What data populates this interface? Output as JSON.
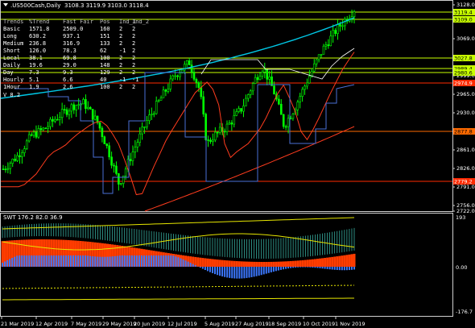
{
  "chart_window": {
    "symbol_title": ".US500Cash,Daily",
    "ohlc_text": "3108.3 3119.9 3103.0 3118.4"
  },
  "panel_table": {
    "headers": [
      "Trends",
      "%Trend",
      "Fast Fair",
      "Pos",
      "Ind_1",
      "Ind_2"
    ],
    "rows": [
      {
        "name": "Basic",
        "c1": "1571.8",
        "c2": "2509.0",
        "c3": "160",
        "c4": "2",
        "c5": "2"
      },
      {
        "name": "Long",
        "c1": "630.2",
        "c2": "937.1",
        "c3": "151",
        "c4": "2",
        "c5": "2"
      },
      {
        "name": "Medium",
        "c1": "236.8",
        "c2": "316.9",
        "c3": "133",
        "c4": "2",
        "c5": "2"
      },
      {
        "name": "Short",
        "c1": "126.0",
        "c2": "78.3",
        "c3": "62",
        "c4": "-1",
        "c5": "2"
      },
      {
        "name": "Local",
        "c1": "38.1",
        "c2": "69.8",
        "c3": "100",
        "c4": "2",
        "c5": "2"
      },
      {
        "name": "Daily",
        "c1": "19.6",
        "c2": "29.0",
        "c3": "148",
        "c4": "2",
        "c5": "2"
      },
      {
        "name": "Day",
        "c1": "7.3",
        "c2": "9.3",
        "c3": "129",
        "c4": "2",
        "c5": "2"
      },
      {
        "name": "Hourly",
        "c1": "5.1",
        "c2": "6.6",
        "c3": "40",
        "c4": "-1",
        "c5": "-1"
      },
      {
        "name": "1Hour",
        "c1": "1.9",
        "c2": "2.6",
        "c3": "100",
        "c4": "2",
        "c5": "2"
      }
    ],
    "footer": "V 8.2"
  },
  "price_scale": [
    "3128.0",
    "3104.0",
    "3069.0",
    "3034.0",
    "2999.0",
    "2965.0",
    "2930.0",
    "2896.0",
    "2861.0",
    "2826.0",
    "2791.0",
    "2756.0",
    "2722.0"
  ],
  "price_tags": [
    {
      "value": "3119.4",
      "color": "#c8ff00",
      "text_color": "#000000"
    },
    {
      "value": "3109.0",
      "color": "#c8ff00",
      "text_color": "#000000"
    },
    {
      "value": "3027.8",
      "color": "#c8ff00",
      "text_color": "#000000"
    },
    {
      "value": "2989.4",
      "color": "#c8ff00",
      "text_color": "#000000"
    },
    {
      "value": "2980.6",
      "color": "#c8ff00",
      "text_color": "#000000"
    },
    {
      "value": "2974.9",
      "color": "#ff2a00",
      "text_color": "#ffffff"
    },
    {
      "value": "2877.8",
      "color": "#ff6a00",
      "text_color": "#000000"
    },
    {
      "value": "2779.2",
      "color": "#ff2a00",
      "text_color": "#ffffff"
    }
  ],
  "subwindow": {
    "title": "SWT 176.2 82.0 36.9",
    "scale": [
      "193",
      "0.00",
      "-176.7"
    ]
  },
  "time_axis": [
    "21 Mar 2019",
    "12 Apr 2019",
    "7 May 2019",
    "29 May 2019",
    "20 Jun 2019",
    "12 Jul 2019",
    "5 Aug 2019",
    "27 Aug 2019",
    "18 Sep 2019",
    "10 Oct 2019",
    "1 Nov 2019"
  ],
  "colors": {
    "background": "#000000",
    "candle": "#00ff00",
    "grid_line": "#c8ff00",
    "ma_cyan": "#00c8e6",
    "ma_red": "#ff3c1e",
    "step_blue": "#4a6fd6",
    "hist_red": "#ff3c00",
    "hist_blue": "#3c78ff",
    "hist_teal": "#3fc6b6"
  }
}
